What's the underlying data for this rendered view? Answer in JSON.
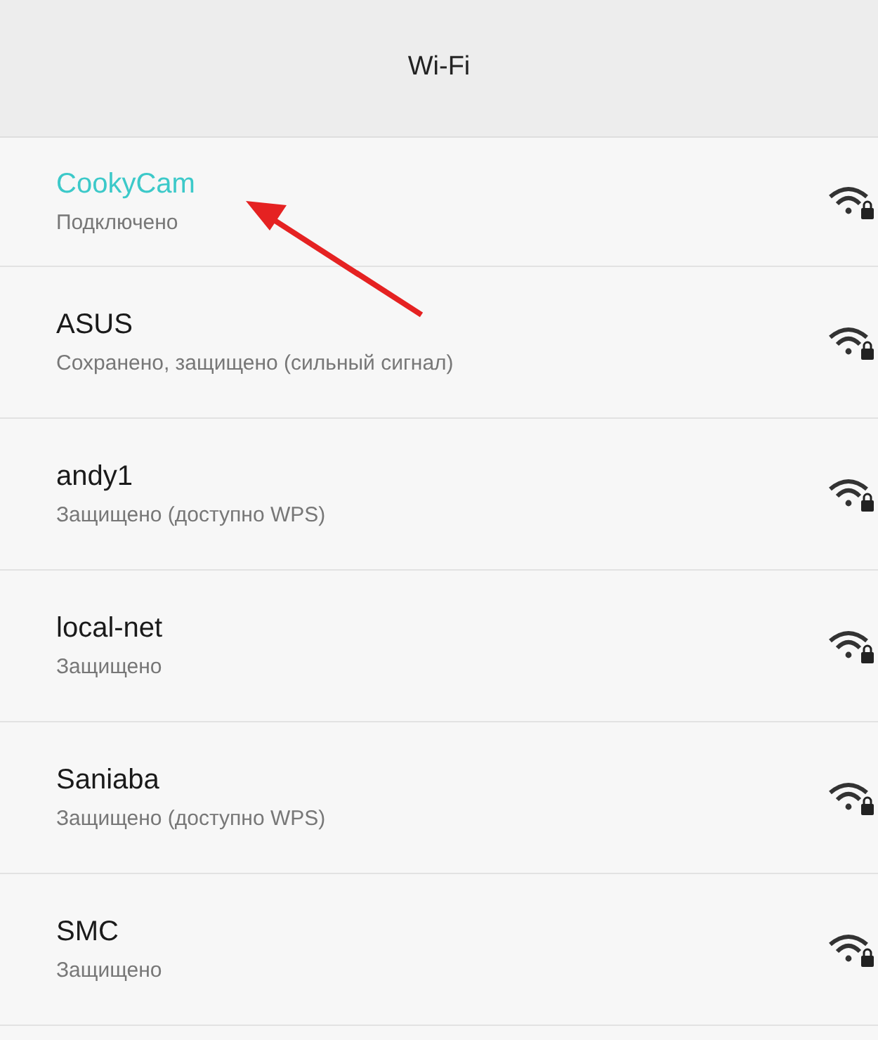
{
  "header": {
    "title": "Wi-Fi"
  },
  "networks": [
    {
      "name": "CookyCam",
      "status": "Подключено",
      "connected": true
    },
    {
      "name": "ASUS",
      "status": "Сохранено, защищено (сильный сигнал)",
      "connected": false
    },
    {
      "name": "andy1",
      "status": "Защищено (доступно WPS)",
      "connected": false
    },
    {
      "name": "local-net",
      "status": "Защищено",
      "connected": false
    },
    {
      "name": "Saniaba",
      "status": "Защищено (доступно WPS)",
      "connected": false
    },
    {
      "name": "SMC",
      "status": "Защищено",
      "connected": false
    }
  ]
}
